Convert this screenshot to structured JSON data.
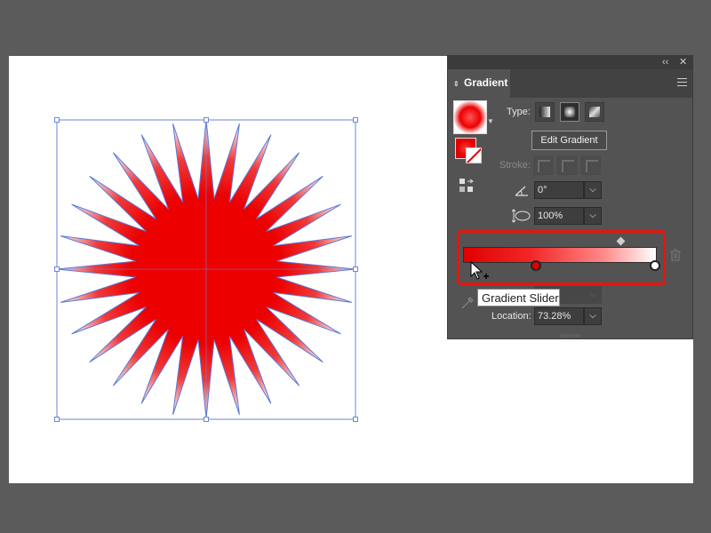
{
  "panel": {
    "collapse_icon": "double-chevron-left-icon",
    "close_icon": "close-icon",
    "tab_label": "Gradient",
    "menu_icon": "hamburger-menu-icon"
  },
  "type_section": {
    "label": "Type:",
    "options": [
      "linear",
      "radial",
      "freeform"
    ],
    "selected": "radial",
    "edit_button": "Edit Gradient"
  },
  "stroke_section": {
    "label": "Stroke:",
    "enabled": false
  },
  "angle": {
    "icon": "angle-icon",
    "value": "0°"
  },
  "aspect_ratio": {
    "icon": "aspect-ratio-icon",
    "value": "100%"
  },
  "gradient_slider": {
    "tooltip": "Gradient Slider",
    "stops": [
      {
        "color": "#dc0000",
        "location": 0.38,
        "selected": true
      },
      {
        "color": "#ffffff",
        "location": 1.0,
        "selected": false
      }
    ],
    "midpoint": 0.82
  },
  "location": {
    "label": "Location:",
    "value": "73.28%"
  },
  "colors": {
    "highlight": "#e8140f",
    "fill": "#ec0000",
    "panel_bg": "#535353",
    "canvas_bg": "#5b5b5b",
    "selection": "#6b87d6"
  },
  "artwork": {
    "shape": "starburst",
    "points": 28
  }
}
